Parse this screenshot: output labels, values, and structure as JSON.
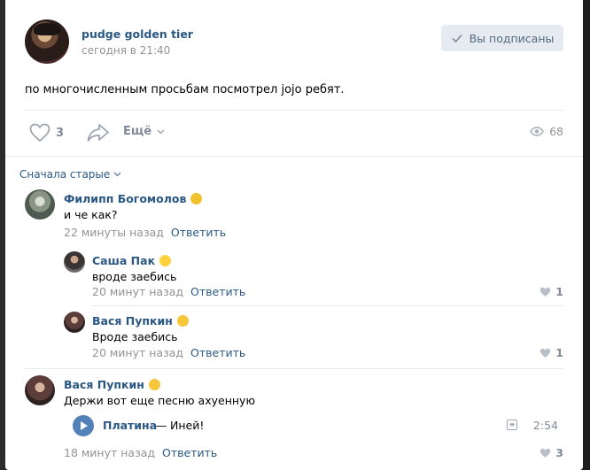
{
  "post": {
    "author": "pudge golden tier",
    "date": "сегодня в 21:40",
    "subscribe_label": "Вы подписаны",
    "text": "по многочисленным просьбам посмотрел jojo ребят.",
    "likes": "3",
    "more_label": "Ещё",
    "views": "68"
  },
  "comments_sort": "Сначала старые",
  "comments": [
    {
      "author": "Филипп Богомолов",
      "emoji": "cat-face-emoji",
      "text": "и че как?",
      "time": "22 минуты назад",
      "reply_label": "Ответить"
    },
    {
      "author": "Саша Пак",
      "emoji": "chick-emoji",
      "text": "вроде заебись",
      "time": "20 минут назад",
      "reply_label": "Ответить",
      "likes": "1"
    },
    {
      "author": "Вася Пупкин",
      "emoji": "sunglasses-emoji",
      "text": "Вроде заебись",
      "time": "20 минут назад",
      "reply_label": "Ответить",
      "likes": "1"
    },
    {
      "author": "Вася Пупкин",
      "emoji": "sunglasses-emoji",
      "text": "Держи вот еще песню ахуенную",
      "time": "18 минут назад",
      "reply_label": "Ответить",
      "likes": "3",
      "audio": {
        "artist": "Платина",
        "separator": "—",
        "title": "Иней!",
        "duration": "2:54"
      }
    }
  ],
  "colors": {
    "link": "#2a5885",
    "muted": "#939393",
    "button_bg": "#e5ebf1",
    "play": "#5181b8"
  }
}
